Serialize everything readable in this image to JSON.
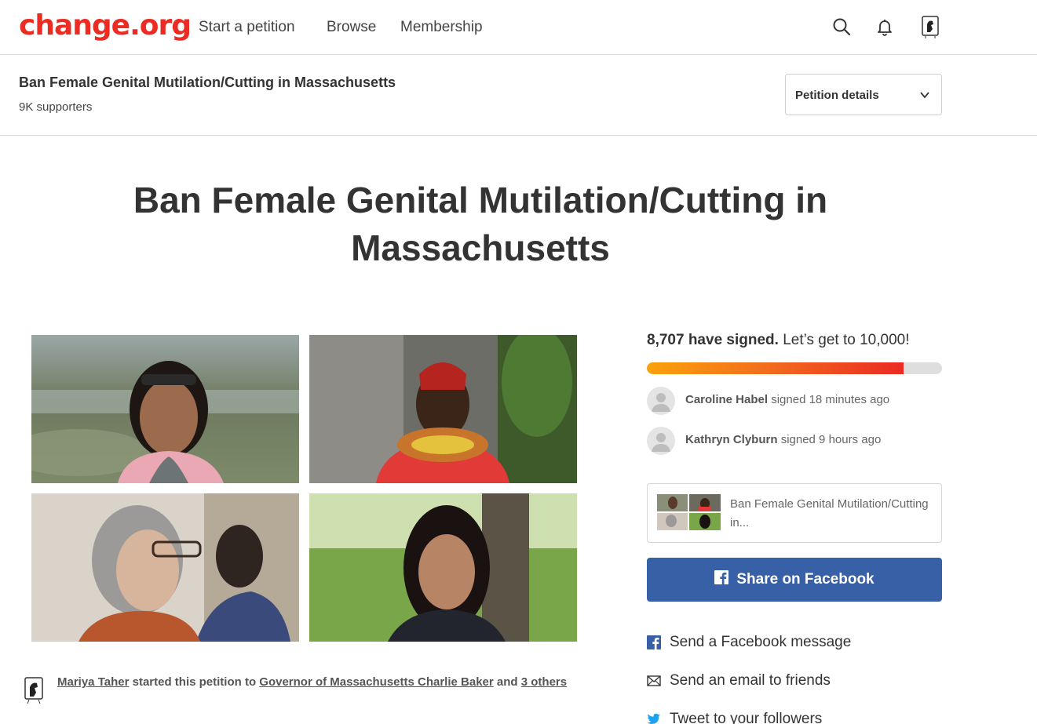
{
  "nav": {
    "logo": "change.org",
    "links": [
      "Start a petition",
      "Browse",
      "Membership"
    ]
  },
  "subbar": {
    "title": "Ban Female Genital Mutilation/Cutting in Massachusetts",
    "supporters": "9K supporters",
    "details_label": "Petition details"
  },
  "petition": {
    "title": "Ban Female Genital Mutilation/Cutting in Massachusetts"
  },
  "creator": {
    "name": "Mariya Taher",
    "text_1": "started this petition to",
    "target": "Governor of Massachusetts Charlie Baker",
    "text_2": "and",
    "others": "3 others"
  },
  "signatures": {
    "count_text": "8,707 have signed.",
    "goal_text": "Let’s get to 10,000!",
    "progress": 0.8707,
    "recent": [
      {
        "name": "Caroline Habel",
        "action": "signed 18 minutes ago"
      },
      {
        "name": "Kathryn Clyburn",
        "action": "signed 9 hours ago"
      }
    ]
  },
  "share": {
    "card_text": "Ban Female Genital Mutilation/Cutting in...",
    "facebook_button": "Share on Facebook",
    "links": [
      {
        "icon": "facebook-square-icon",
        "label": "Send a Facebook message"
      },
      {
        "icon": "email-icon",
        "label": "Send an email to friends"
      },
      {
        "icon": "twitter-icon",
        "label": "Tweet to your followers"
      }
    ]
  },
  "colors": {
    "brand": "#ec2c22",
    "facebook": "#3760a6",
    "progress_start": "#fba10d",
    "progress_end": "#eb2a24"
  }
}
